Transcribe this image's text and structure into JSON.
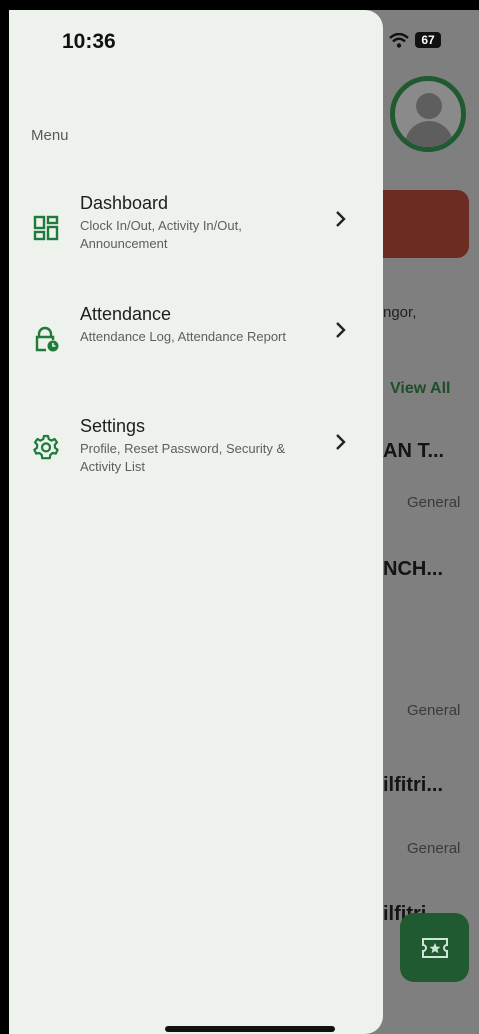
{
  "status_bar": {
    "time": "10:36",
    "battery": "67"
  },
  "background_page": {
    "location_fragment": "ngor,",
    "view_all": "View All",
    "items": [
      {
        "title": "AN T...",
        "category": "General"
      },
      {
        "title": "NCH...",
        "category": "General"
      },
      {
        "title": "ilfitri...",
        "category": "General"
      },
      {
        "title": "ilfitri..."
      }
    ]
  },
  "drawer": {
    "menu_label": "Menu",
    "items": [
      {
        "title": "Dashboard",
        "subtitle": "Clock In/Out, Activity In/Out, Announcement",
        "icon": "dashboard-icon"
      },
      {
        "title": "Attendance",
        "subtitle": "Attendance Log, Attendance Report",
        "icon": "lock-clock-icon"
      },
      {
        "title": "Settings",
        "subtitle": "Profile, Reset Password, Security & Activity List",
        "icon": "gear-icon"
      }
    ]
  },
  "colors": {
    "accent": "#1f7a3c",
    "drawer_bg": "#eef2ec",
    "fab": "#1f5a30"
  }
}
